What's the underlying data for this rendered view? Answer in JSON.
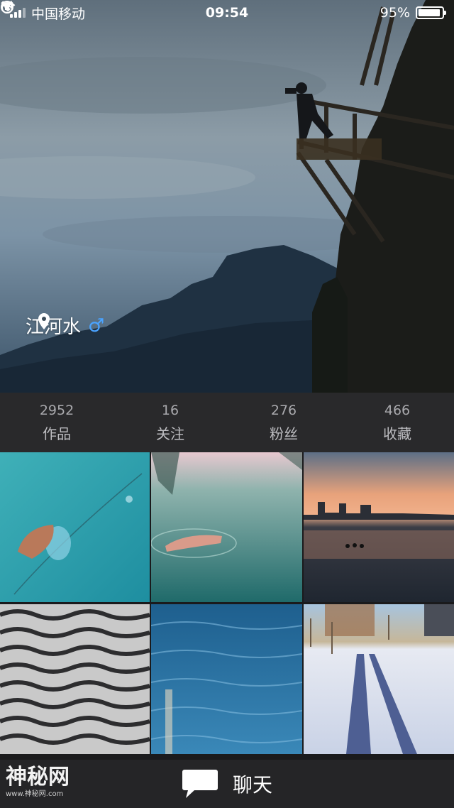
{
  "status_bar": {
    "carrier": "中国移动",
    "time": "09:54",
    "battery": "95%",
    "battery_level": 0.95
  },
  "profile": {
    "name": "江河水",
    "gender_symbol": "♂"
  },
  "stats": [
    {
      "number": "2952",
      "label": "作品"
    },
    {
      "number": "16",
      "label": "关注"
    },
    {
      "number": "276",
      "label": "粉丝"
    },
    {
      "number": "466",
      "label": "收藏"
    }
  ],
  "bottom_bar": {
    "chat_label": "聊天"
  },
  "watermark": {
    "main": "神秘网",
    "sub": "www.神秘网.com"
  }
}
